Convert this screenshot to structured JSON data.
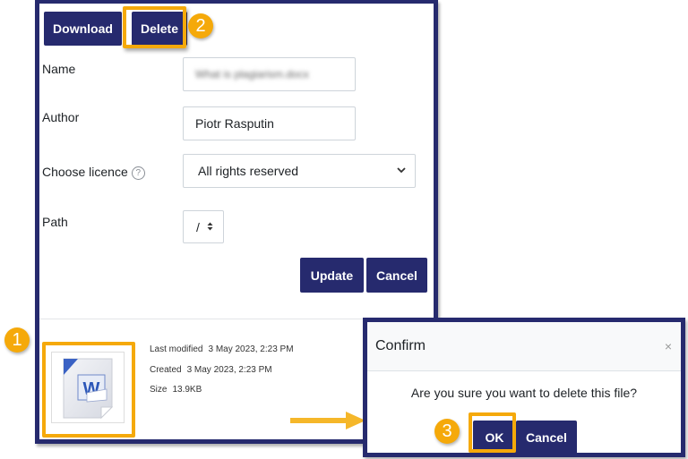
{
  "toolbar": {
    "download_label": "Download",
    "delete_label": "Delete"
  },
  "form": {
    "name_label": "Name",
    "name_value": "What is plagiarism.docx",
    "author_label": "Author",
    "author_value": "Piotr Rasputin",
    "licence_label": "Choose licence",
    "licence_value": "All rights reserved",
    "path_label": "Path",
    "path_value": "/",
    "update_label": "Update",
    "cancel_label": "Cancel"
  },
  "file_info": {
    "last_modified_label": "Last modified",
    "last_modified_value": "3 May 2023, 2:23 PM",
    "created_label": "Created",
    "created_value": "3 May 2023, 2:23 PM",
    "size_label": "Size",
    "size_value": "13.9KB",
    "file_icon": "word-document-icon"
  },
  "confirm_dialog": {
    "title": "Confirm",
    "close_glyph": "×",
    "message": "Are you sure you want to delete this file?",
    "ok_label": "OK",
    "cancel_label": "Cancel"
  },
  "annotations": {
    "step1": "1",
    "step2": "2",
    "step3": "3"
  },
  "icons": {
    "help": "?",
    "chevron": "⌄",
    "spinner": "⬍"
  },
  "colors": {
    "brand": "#262a6e",
    "highlight": "#f5a90a"
  }
}
